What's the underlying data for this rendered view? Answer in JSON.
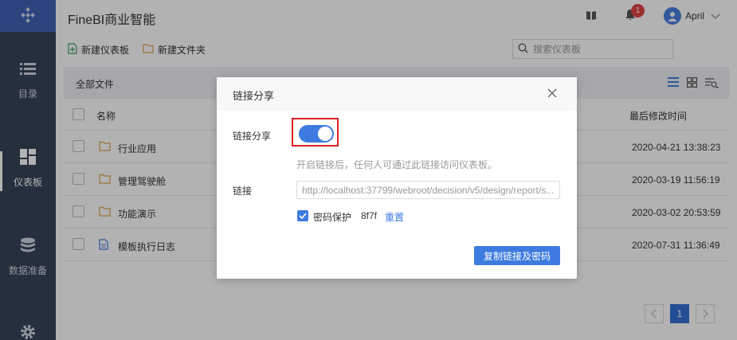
{
  "app": {
    "title": "FineBI商业智能"
  },
  "header": {
    "notification_count": "1",
    "user_name": "April"
  },
  "sidebar": {
    "items": [
      {
        "label": "目录",
        "icon": "list-icon"
      },
      {
        "label": "仪表板",
        "icon": "dashboard-icon",
        "active": true
      },
      {
        "label": "数据准备",
        "icon": "database-icon"
      },
      {
        "label": "",
        "icon": "gear-icon"
      }
    ]
  },
  "toolbar": {
    "new_dashboard": "新建仪表板",
    "new_folder": "新建文件夹",
    "search_placeholder": "搜索仪表板"
  },
  "list": {
    "title": "全部文件",
    "columns": {
      "name": "名称",
      "modified": "最后修改时间"
    },
    "rows": [
      {
        "name": "行业应用",
        "type": "folder",
        "modified": "2020-04-21 13:38:23"
      },
      {
        "name": "管理驾驶舱",
        "type": "folder",
        "modified": "2020-03-19 11:56:19"
      },
      {
        "name": "功能演示",
        "type": "folder",
        "modified": "2020-03-02 20:53:59"
      },
      {
        "name": "模板执行日志",
        "type": "file",
        "modified": "2020-07-31 11:36:49"
      }
    ]
  },
  "pager": {
    "current": "1"
  },
  "dialog": {
    "title": "链接分享",
    "share_label": "链接分享",
    "share_enabled": true,
    "hint": "开启链接后，任何人可通过此链接访问仪表板。",
    "link_label": "链接",
    "link_value": "http://localhost:37799/webroot/decision/v5/design/report/s...",
    "password_label": "密码保护",
    "password_checked": true,
    "password_value": "8f7f",
    "reset_label": "重置",
    "copy_button": "复制链接及密码"
  },
  "colors": {
    "accent": "#3d7be0",
    "sidebar": "#374458",
    "highlight": "#e02020"
  }
}
